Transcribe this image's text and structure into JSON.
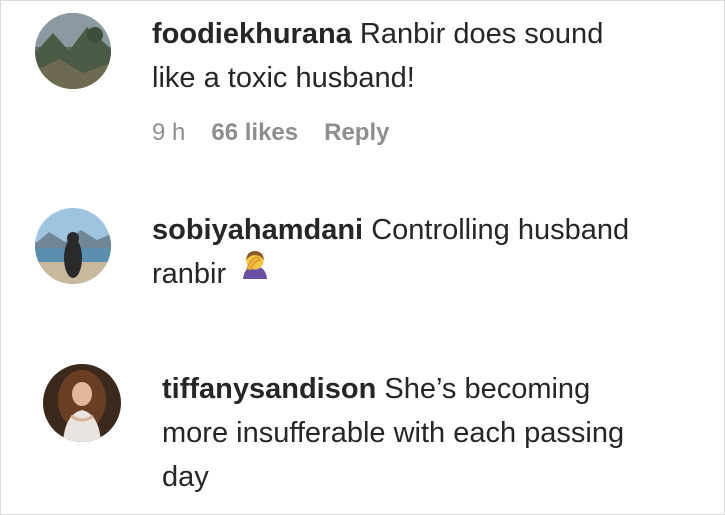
{
  "comments": [
    {
      "username": "foodiekhurana",
      "text_line1": "Ranbir does sound",
      "text_line2": "like a toxic husband!",
      "time": "9 h",
      "likes": "66 likes",
      "reply": "Reply",
      "avatar": "avatar-landscape"
    },
    {
      "username": "sobiyahamdani",
      "text_line1": "Controlling husband",
      "text_line2": "ranbir",
      "emoji": "facepalm-woman-icon",
      "avatar": "avatar-lake-person"
    },
    {
      "username": "tiffanysandison",
      "text_line1": "She’s becoming",
      "text_line2": "more insufferable with each passing",
      "text_line3": "day",
      "avatar": "avatar-portrait"
    }
  ],
  "colors": {
    "text": "#262626",
    "meta": "#8e8e8e",
    "border": "#dbdbdb"
  }
}
